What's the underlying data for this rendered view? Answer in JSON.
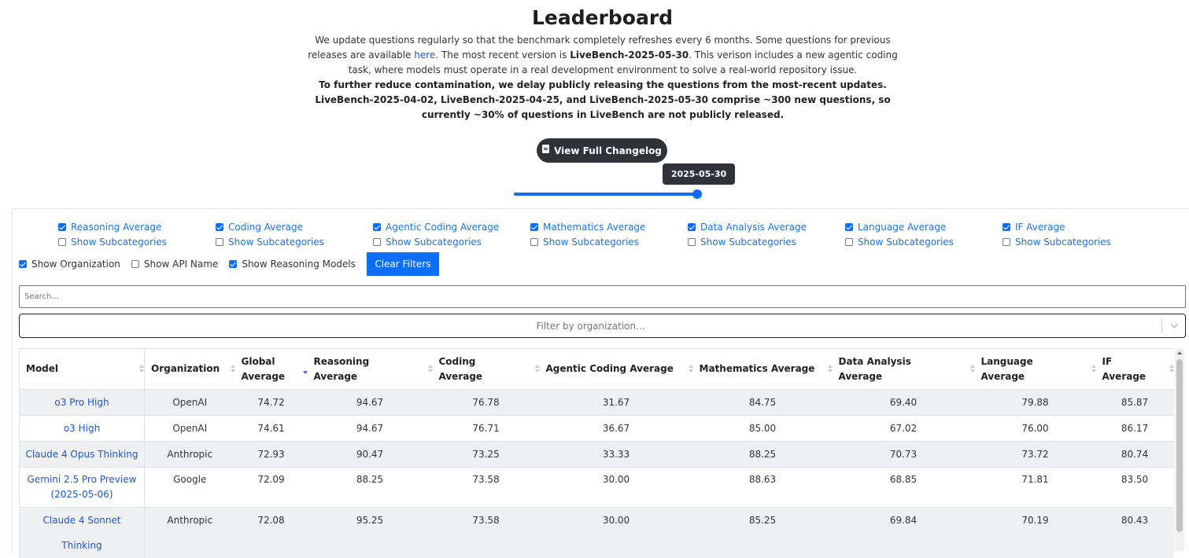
{
  "header": {
    "title": "Leaderboard",
    "intro_1": "We update questions regularly so that the benchmark completely refreshes every 6 months. Some questions for previous releases are available ",
    "intro_link": "here",
    "intro_2": ". The most recent version is ",
    "intro_version": "LiveBench-2025-05-30",
    "intro_3": ". This verison includes a new agentic coding task, where models must operate in a real development environment to solve a real-world repository issue.",
    "intro_bold": "To further reduce contamination, we delay publicly releasing the questions from the most-recent updates. LiveBench-2025-04-02, LiveBench-2025-04-25, and LiveBench-2025-05-30 comprise ~300 new questions, so currently ~30% of questions in LiveBench are not publicly released.",
    "changelog_button": "View Full Changelog",
    "slider_value": "2025-05-30",
    "slider_position_fraction": 1.0
  },
  "filters": {
    "categories": [
      {
        "label": "Reasoning Average",
        "checked": true,
        "sub_label": "Show Subcategories"
      },
      {
        "label": "Coding Average",
        "checked": true,
        "sub_label": "Show Subcategories"
      },
      {
        "label": "Agentic Coding Average",
        "checked": true,
        "sub_label": "Show Subcategories"
      },
      {
        "label": "Mathematics Average",
        "checked": true,
        "sub_label": "Show Subcategories"
      },
      {
        "label": "Data Analysis Average",
        "checked": true,
        "sub_label": "Show Subcategories"
      },
      {
        "label": "Language Average",
        "checked": true,
        "sub_label": "Show Subcategories"
      },
      {
        "label": "IF Average",
        "checked": true,
        "sub_label": "Show Subcategories"
      }
    ],
    "show_organization": "Show Organization",
    "show_api_name": "Show API Name",
    "show_reasoning_models": "Show Reasoning Models",
    "clear_filters": "Clear Filters",
    "search_placeholder": "Search...",
    "org_placeholder": "Filter by organization..."
  },
  "table": {
    "headers": [
      "Model",
      "Organization",
      "Global Average",
      "Reasoning Average",
      "Coding Average",
      "Agentic Coding Average",
      "Mathematics Average",
      "Data Analysis Average",
      "Language Average",
      "IF Average"
    ],
    "rows": [
      [
        "o3 Pro High",
        "OpenAI",
        "74.72",
        "94.67",
        "76.78",
        "31.67",
        "84.75",
        "69.40",
        "79.88",
        "85.87"
      ],
      [
        "o3 High",
        "OpenAI",
        "74.61",
        "94.67",
        "76.71",
        "36.67",
        "85.00",
        "67.02",
        "76.00",
        "86.17"
      ],
      [
        "Claude 4 Opus Thinking",
        "Anthropic",
        "72.93",
        "90.47",
        "73.25",
        "33.33",
        "88.25",
        "70.73",
        "73.72",
        "80.74"
      ],
      [
        "Gemini 2.5 Pro Preview (2025-05-06)",
        "Google",
        "72.09",
        "88.25",
        "73.58",
        "30.00",
        "88.63",
        "68.85",
        "71.81",
        "83.50"
      ],
      [
        "Claude 4 Sonnet Thinking",
        "Anthropic",
        "72.08",
        "95.25",
        "73.58",
        "30.00",
        "85.25",
        "69.84",
        "70.19",
        "80.43"
      ]
    ]
  }
}
